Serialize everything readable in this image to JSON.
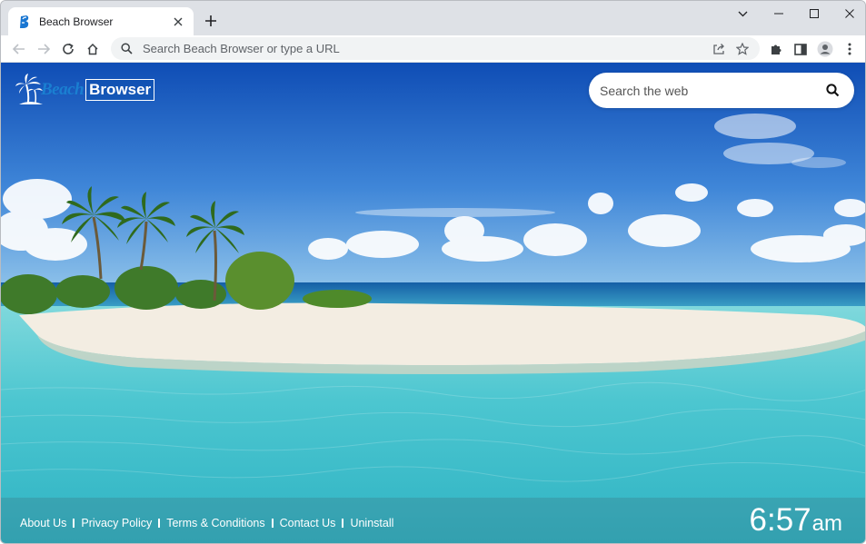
{
  "browser": {
    "tab": {
      "title": "Beach Browser",
      "favicon": "beach-browser-favicon",
      "close_icon": "close-icon"
    },
    "new_tab_icon": "plus-icon",
    "window_controls": [
      "chevron-down-icon",
      "minimize-icon",
      "maximize-icon",
      "close-icon"
    ],
    "toolbar": {
      "nav": [
        "back-arrow-icon",
        "forward-arrow-icon",
        "reload-icon",
        "home-icon"
      ],
      "omnibox": {
        "placeholder": "Search Beach Browser or type a URL",
        "value": ""
      },
      "omnibox_icons": [
        "share-icon",
        "bookmark-star-icon"
      ],
      "right_icons": [
        "extensions-puzzle-icon",
        "side-panel-icon",
        "profile-avatar-icon",
        "kebab-menu-icon"
      ]
    }
  },
  "page": {
    "logo": {
      "part1": "Beach",
      "part2": "Browser"
    },
    "search": {
      "placeholder": "Search the web",
      "value": "",
      "icon": "search-icon"
    },
    "footer": {
      "links": [
        "About Us",
        "Privacy Policy",
        "Terms & Conditions",
        "Contact Us",
        "Uninstall"
      ]
    },
    "clock": {
      "time": "6:57",
      "ampm": "am"
    }
  },
  "colors": {
    "accent": "#1a7fd1",
    "sky_top": "#1550b8",
    "sea": "#45c7d0",
    "sand": "#f3ede2"
  }
}
